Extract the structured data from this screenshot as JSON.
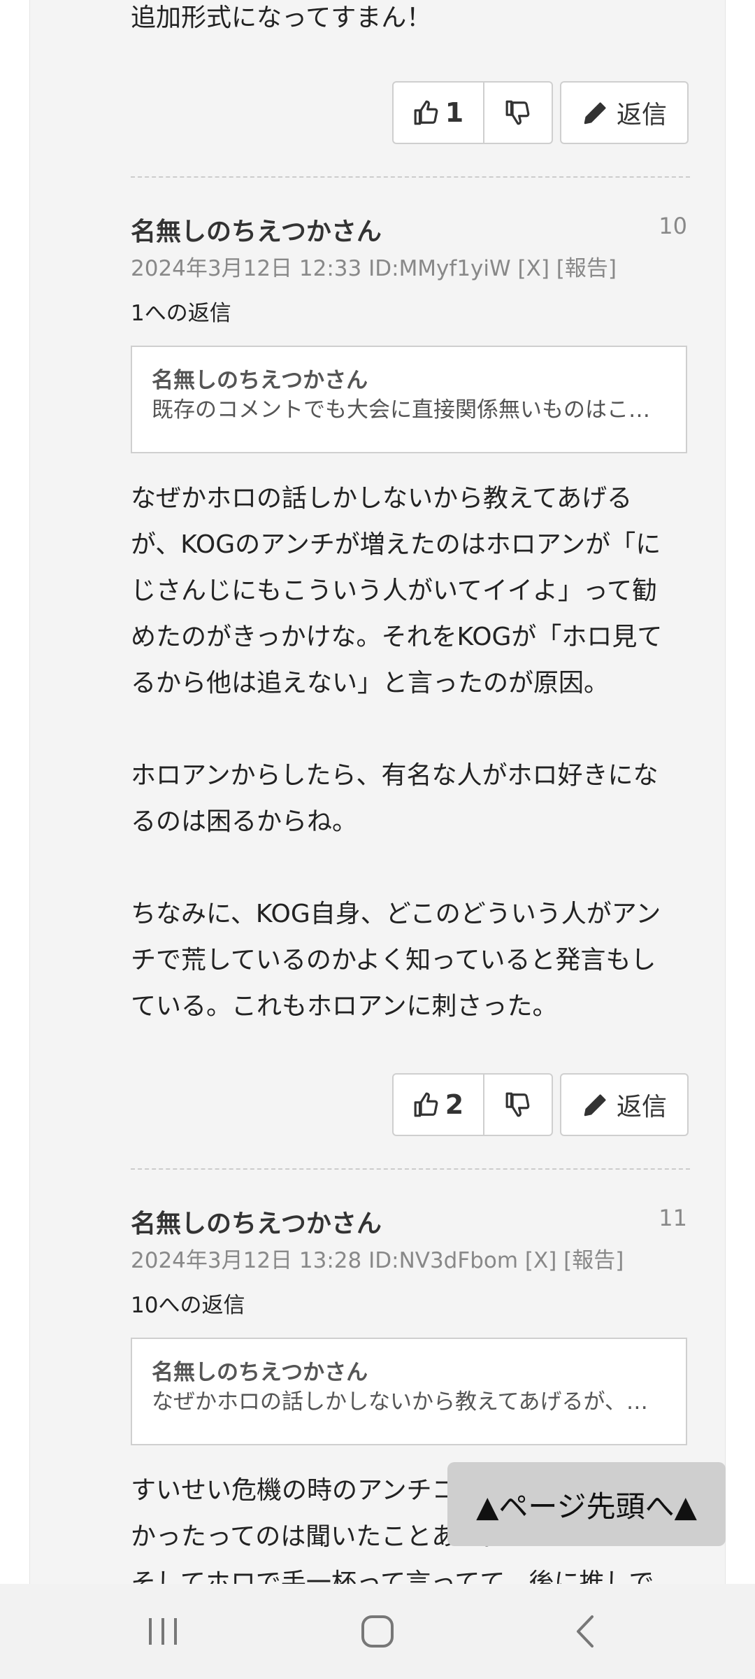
{
  "top_comment": {
    "tail_text": "追加形式になってすまん！",
    "likes": "1",
    "reply_label": "返信"
  },
  "comments": [
    {
      "author": "名無しのちえつかさん",
      "number": "10",
      "meta": "2024年3月12日 12:33 ID:MMyf1yiW [X] [報告]",
      "reply_to": "1への返信",
      "quote_author": "名無しのちえつかさん",
      "quote_text": "既存のコメントでも大会に直接関係無いものはこ…",
      "body": "なぜかホロの話しかしないから教えてあげる\nが、KOGのアンチが増えたのはホロアンが「に\nじさんじにもこういう人がいてイイよ」って勧\nめたのがきっかけな。それをKOGが「ホロ見て\nるから他は追えない」と言ったのが原因。\n\nホロアンからしたら、有名な人がホロ好きにな\nるのは困るからね。\n\nちなみに、KOG自身、どこのどういう人がアン\nチで荒しているのかよく知っていると発言もし\nている。これもホロアンに刺さった。",
      "likes": "2",
      "reply_label": "返信"
    },
    {
      "author": "名無しのちえつかさん",
      "number": "11",
      "meta": "2024年3月12日 13:28 ID:NV3dFbom [X] [報告]",
      "reply_to": "10への返信",
      "quote_author": "名無しのちえつかさん",
      "quote_text": "なぜかホロの話しかしないから教えてあげるが、…",
      "body": "すいせい危機の時のアンチコメ\nかったってのは聞いたことある。\nそしてホロで手一杯って言ってて、後に推しで"
    }
  ],
  "to_top_label": "▲ページ先頭へ▲",
  "navbar": {
    "recents": "recents-icon",
    "home": "home-icon",
    "back": "back-icon"
  }
}
